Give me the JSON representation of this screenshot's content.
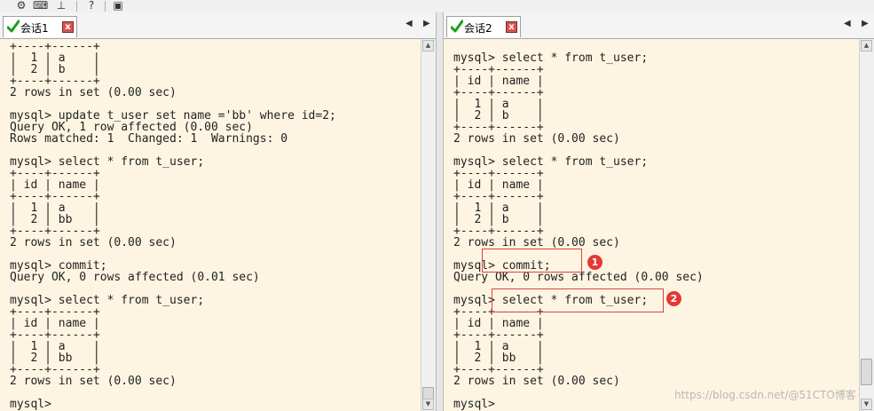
{
  "toolbar": {
    "icons": [
      "gear-icon",
      "keyboard-icon",
      "pin-icon",
      "help-icon",
      "window-icon"
    ]
  },
  "session1": {
    "tab_label": "会话1",
    "close_label": "x",
    "nav_prev": "◀",
    "nav_next": "▶",
    "lines": [
      "+----+------+",
      "|  1 | a    |",
      "|  2 | b    |",
      "+----+------+",
      "2 rows in set (0.00 sec)",
      "",
      "mysql> update t_user set name ='bb' where id=2;",
      "Query OK, 1 row affected (0.00 sec)",
      "Rows matched: 1  Changed: 1  Warnings: 0",
      "",
      "mysql> select * from t_user;",
      "+----+------+",
      "| id | name |",
      "+----+------+",
      "|  1 | a    |",
      "|  2 | bb   |",
      "+----+------+",
      "2 rows in set (0.00 sec)",
      "",
      "mysql> commit;",
      "Query OK, 0 rows affected (0.01 sec)",
      "",
      "mysql> select * from t_user;",
      "+----+------+",
      "| id | name |",
      "+----+------+",
      "|  1 | a    |",
      "|  2 | bb   |",
      "+----+------+",
      "2 rows in set (0.00 sec)",
      "",
      "mysql>"
    ]
  },
  "session2": {
    "tab_label": "会话2",
    "close_label": "x",
    "nav_prev": "◀",
    "nav_next": "▶",
    "lines": [
      "",
      "mysql> select * from t_user;",
      "+----+------+",
      "| id | name |",
      "+----+------+",
      "|  1 | a    |",
      "|  2 | b    |",
      "+----+------+",
      "2 rows in set (0.00 sec)",
      "",
      "mysql> select * from t_user;",
      "+----+------+",
      "| id | name |",
      "+----+------+",
      "|  1 | a    |",
      "|  2 | b    |",
      "+----+------+",
      "2 rows in set (0.00 sec)",
      "",
      "mysql> commit;",
      "Query OK, 0 rows affected (0.00 sec)",
      "",
      "mysql> select * from t_user;",
      "+----+------+",
      "| id | name |",
      "+----+------+",
      "|  1 | a    |",
      "|  2 | bb   |",
      "+----+------+",
      "2 rows in set (0.00 sec)",
      "",
      "mysql>"
    ]
  },
  "annotations": [
    {
      "number": "1",
      "color": "#e53935"
    },
    {
      "number": "2",
      "color": "#e53935"
    }
  ],
  "watermark": "https://blog.csdn.net/@51CTO博客"
}
